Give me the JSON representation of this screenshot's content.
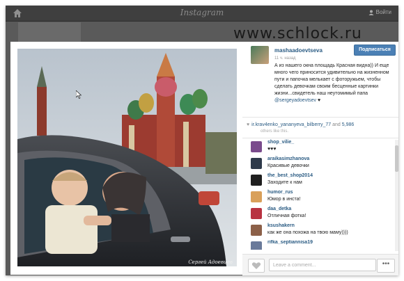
{
  "topbar": {
    "brand": "Instagram",
    "login": "Войти"
  },
  "watermark": "www.schlock.ru",
  "photo": {
    "caption": "Сергей Адоевцев"
  },
  "post": {
    "author": "mashaadoevtseva",
    "follow_label": "Подписаться",
    "time": "11 ч. назад",
    "text": "А из нашего окна площадь Красная видна)) И еще много чего приносится удивительно на жизненном пути и папочка мелькает с фоторужьем, чтобы сделать девочкам своим бесценные картинки жизни...свидетель наш неутомимый папа ",
    "mention": "@sergeyadoevtsev",
    "heart": "♥"
  },
  "likes": {
    "users": "ir.krav4enko_yananyeva_bilberry_77",
    "and": "and",
    "count": "5,986",
    "suffix": "others like this."
  },
  "comments": [
    {
      "user": "shop_vilie_",
      "text": "♥♥♥",
      "color": "#7a4b8c"
    },
    {
      "user": "araikasimzhanova",
      "text": "Красивые девочки",
      "color": "#2e3a4a"
    },
    {
      "user": "the_best_shop2014",
      "text": "Заходите к нам",
      "color": "#1f1f1f"
    },
    {
      "user": "humor_rus",
      "text": "Юмор в инста!",
      "color": "#d9a05a"
    },
    {
      "user": "daa_detka",
      "text": "Отличная фотка!",
      "color": "#b83240"
    },
    {
      "user": "ksushakern",
      "text": "как же она похожа на твою маму))))",
      "color": "#8c6048"
    },
    {
      "user": "rifka_septiannisa19",
      "text": "",
      "color": "#6a7a9a"
    }
  ],
  "comment_bar": {
    "placeholder": "Leave a comment...",
    "more": "•••"
  },
  "colors": {
    "accent": "#4b80b5",
    "link": "#2a5b83"
  }
}
